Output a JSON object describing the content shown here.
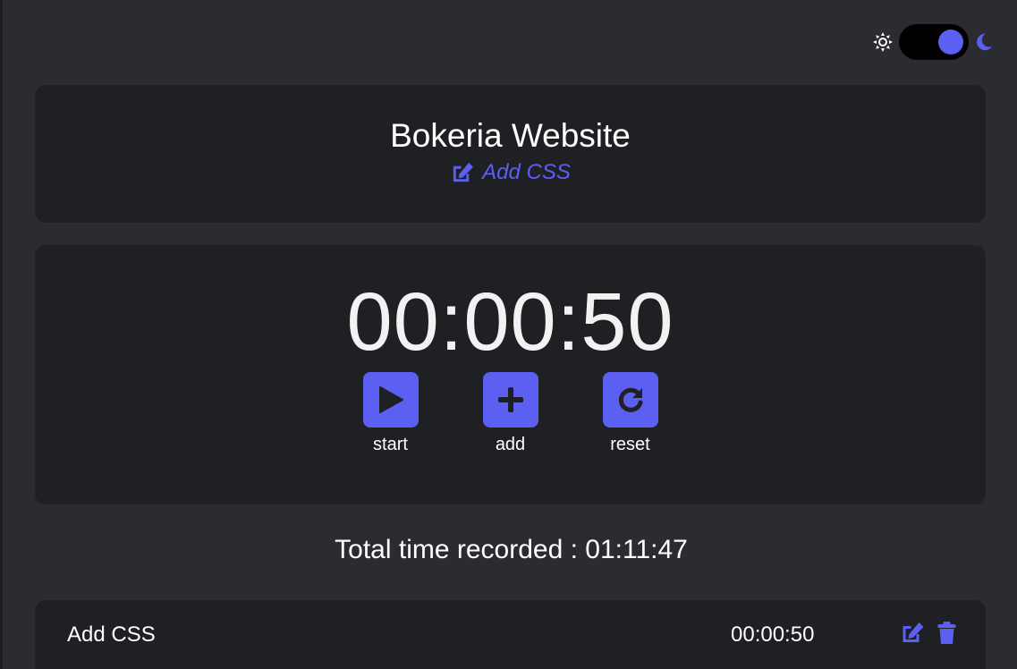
{
  "theme": {
    "mode": "dark",
    "accent": "#5b5ff2",
    "background": "#2b2c31",
    "card_background": "#1f2024",
    "sun_icon": "sun-icon",
    "moon_icon": "moon-icon"
  },
  "project": {
    "title": "Bokeria Website",
    "current_task": "Add CSS",
    "edit_icon": "edit-icon"
  },
  "timer": {
    "display": "00:00:50",
    "controls": [
      {
        "label": "start",
        "icon": "play-icon"
      },
      {
        "label": "add",
        "icon": "plus-icon"
      },
      {
        "label": "reset",
        "icon": "redo-icon"
      }
    ]
  },
  "total": {
    "text": "Total time recorded : 01:11:47"
  },
  "log": [
    {
      "name": "Add CSS",
      "time": "00:00:50",
      "icons": [
        "edit-icon",
        "trash-icon"
      ]
    }
  ]
}
